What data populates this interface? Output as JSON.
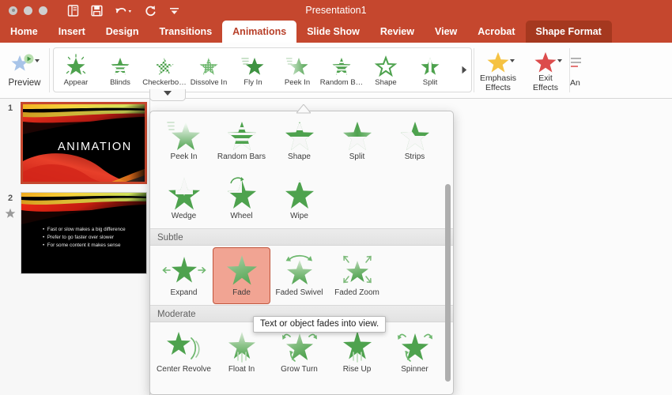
{
  "window": {
    "title": "Presentation1",
    "traffic_lights": [
      "close-button",
      "minimize-button",
      "zoom-button"
    ],
    "quick_access": [
      {
        "name": "view-toggle-icon",
        "label": "View"
      },
      {
        "name": "save-icon",
        "label": "Save"
      },
      {
        "name": "undo-icon",
        "label": "Undo"
      },
      {
        "name": "redo-icon",
        "label": "Redo"
      },
      {
        "name": "customize-toolbar-icon",
        "label": "Customize"
      }
    ]
  },
  "tabs": [
    {
      "label": "Home",
      "state": "normal"
    },
    {
      "label": "Insert",
      "state": "normal"
    },
    {
      "label": "Design",
      "state": "normal"
    },
    {
      "label": "Transitions",
      "state": "normal"
    },
    {
      "label": "Animations",
      "state": "active"
    },
    {
      "label": "Slide Show",
      "state": "normal"
    },
    {
      "label": "Review",
      "state": "normal"
    },
    {
      "label": "View",
      "state": "normal"
    },
    {
      "label": "Acrobat",
      "state": "normal"
    },
    {
      "label": "Shape Format",
      "state": "contextual"
    }
  ],
  "ribbon": {
    "preview": {
      "label": "Preview",
      "icon": "preview-star-icon"
    },
    "gallery": [
      {
        "label": "Appear",
        "icon": "appear-star-icon"
      },
      {
        "label": "Blinds",
        "icon": "blinds-star-icon"
      },
      {
        "label": "Checkerbo…",
        "icon": "checkerboard-star-icon"
      },
      {
        "label": "Dissolve In",
        "icon": "dissolve-in-star-icon"
      },
      {
        "label": "Fly In",
        "icon": "fly-in-star-icon"
      },
      {
        "label": "Peek In",
        "icon": "peek-in-star-icon"
      },
      {
        "label": "Random B…",
        "icon": "random-bars-star-icon"
      },
      {
        "label": "Shape",
        "icon": "shape-star-icon"
      },
      {
        "label": "Split",
        "icon": "split-star-icon"
      }
    ],
    "gallery_more": "gallery-more-arrow-icon",
    "gallery_expand": "gallery-expand-caret-icon",
    "effect_buttons": [
      {
        "label_line1": "Emphasis",
        "label_line2": "Effects",
        "icon": "emphasis-star-icon",
        "color": "#f5c242"
      },
      {
        "label_line1": "Exit",
        "label_line2": "Effects",
        "icon": "exit-star-icon",
        "color": "#dc4c4c"
      },
      {
        "label_line1": "An",
        "label_line2": "",
        "icon": "animation-pane-icon",
        "color": "#dc4c4c"
      }
    ]
  },
  "slides": [
    {
      "number": "1",
      "selected": true,
      "has_animation": false,
      "title_text": "ANIMATION",
      "bullets": []
    },
    {
      "number": "2",
      "selected": false,
      "has_animation": true,
      "animation_badge": "animation-star-icon",
      "title_text": "",
      "bullets": [
        "Fast or slow makes a big difference",
        "Prefer to go faster over slower",
        "For some content it makes sense"
      ]
    }
  ],
  "dropdown": {
    "scrollbar": "vertical-scrollbar",
    "rows": [
      {
        "section": null,
        "items": [
          {
            "label": "Peek In",
            "icon": "peek-in-star-icon",
            "selected": false
          },
          {
            "label": "Random Bars",
            "icon": "random-bars-star-icon",
            "selected": false
          },
          {
            "label": "Shape",
            "icon": "shape-star-icon",
            "selected": false
          },
          {
            "label": "Split",
            "icon": "split-star-icon",
            "selected": false
          },
          {
            "label": "Strips",
            "icon": "strips-star-icon",
            "selected": false
          }
        ]
      },
      {
        "section": null,
        "items": [
          {
            "label": "Wedge",
            "icon": "wedge-star-icon",
            "selected": false
          },
          {
            "label": "Wheel",
            "icon": "wheel-star-icon",
            "selected": false
          },
          {
            "label": "Wipe",
            "icon": "wipe-star-icon",
            "selected": false
          }
        ]
      }
    ],
    "section_subtle": "Subtle",
    "subtle_items": [
      {
        "label": "Expand",
        "icon": "expand-star-icon",
        "selected": false
      },
      {
        "label": "Fade",
        "icon": "fade-star-icon",
        "selected": true
      },
      {
        "label": "Faded Swivel",
        "icon": "faded-swivel-star-icon",
        "selected": false
      },
      {
        "label": "Faded Zoom",
        "icon": "faded-zoom-star-icon",
        "selected": false
      }
    ],
    "section_moderate": "Moderate",
    "moderate_items": [
      {
        "label": "Center Revolve",
        "icon": "center-revolve-star-icon",
        "selected": false
      },
      {
        "label": "Float In",
        "icon": "float-in-star-icon",
        "selected": false
      },
      {
        "label": "Grow  Turn",
        "icon": "grow-turn-star-icon",
        "selected": false
      },
      {
        "label": "Rise Up",
        "icon": "rise-up-star-icon",
        "selected": false
      },
      {
        "label": "Spinner",
        "icon": "spinner-star-icon",
        "selected": false
      }
    ],
    "tooltip": "Text or object fades into view."
  },
  "colors": {
    "titlebar": "#c5472e",
    "contextual_tab": "#a5381f",
    "active_tab_text": "#b8402a",
    "selection_border": "#c5472e",
    "selected_item_bg": "#f1a493",
    "effect_green": "#4ea24e",
    "emphasis_yellow": "#f5c242",
    "exit_red": "#dc4c4c"
  }
}
